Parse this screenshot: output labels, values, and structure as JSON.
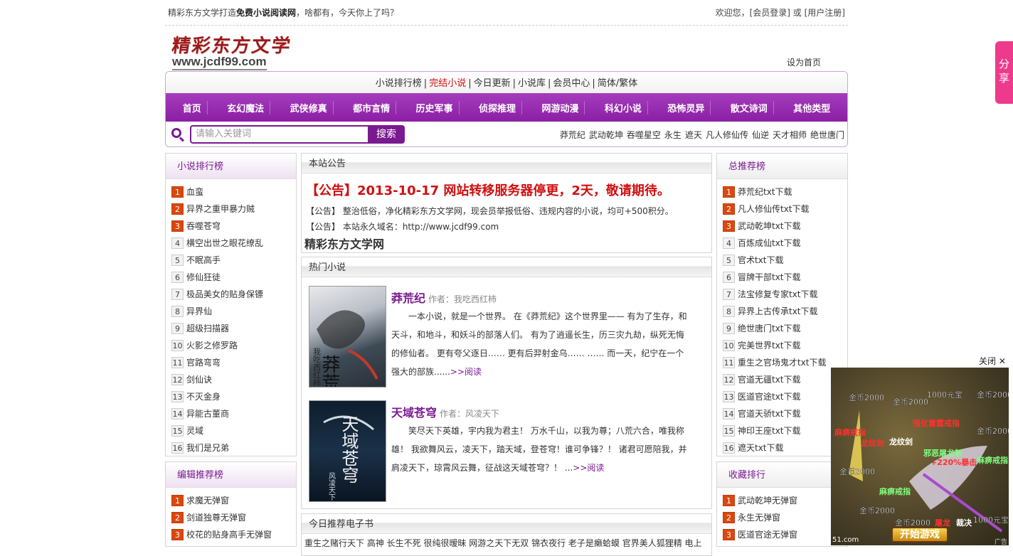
{
  "topbar": {
    "left_prefix": "精彩东方文学打造",
    "left_bold": "免费小说阅读网",
    "left_suffix": "，啥都有，今天你上了吗？",
    "right_welcome": "欢迎您，",
    "login": "[会员登录]",
    "or": " 或 ",
    "register": "[用户注册]"
  },
  "logo": {
    "title": "精彩东方文学",
    "url": "www.jcdf99.com"
  },
  "sethome": "设为首页",
  "subnav": [
    {
      "label": "小说排行榜",
      "red": false
    },
    {
      "label": "完结小说",
      "red": true
    },
    {
      "label": "今日更新",
      "red": false
    },
    {
      "label": "小说库",
      "red": false
    },
    {
      "label": "会员中心",
      "red": false
    },
    {
      "label": "简体/繁体",
      "red": false
    }
  ],
  "mainnav": [
    "首页",
    "玄幻魔法",
    "武侠修真",
    "都市言情",
    "历史军事",
    "侦探推理",
    "网游动漫",
    "科幻小说",
    "恐怖灵异",
    "散文诗词",
    "其他类型"
  ],
  "search": {
    "placeholder": "请输入关键词",
    "button": "搜索"
  },
  "hotwords": [
    "莽荒纪",
    "武动乾坤",
    "吞噬星空",
    "永生",
    "遮天",
    "凡人修仙传",
    "仙逆",
    "天才相师",
    "绝世唐门"
  ],
  "left_rank": {
    "title": "小说排行榜",
    "items": [
      "血蛮",
      "异界之重甲暴力贼",
      "吞噬苍穹",
      "横空出世之眼花缭乱",
      "不眠高手",
      "修仙狂徒",
      "极品美女的贴身保镖",
      "异界仙",
      "超级扫描器",
      "火影之修罗路",
      "官路弯弯",
      "剑仙诀",
      "不灭金身",
      "异能古董商",
      "灵域",
      "我们是兄弟"
    ]
  },
  "left_editor": {
    "title": "编辑推荐榜",
    "items": [
      "求魔无弹窗",
      "剑道独尊无弹窗",
      "校花的贴身高手无弹窗"
    ]
  },
  "notice_panel": {
    "title": "本站公告",
    "main": "【公告】2013-10-17 网站转移服务器停更，2天，敬请期待。",
    "line1": "【公告】 整治低俗，净化精彩东方文学网，现会员举报低俗、违规内容的小说，均可+500积分。",
    "line2": "【公告】 本站永久域名：http://www.jcdf99.com",
    "site": "精彩东方文学网"
  },
  "hot_panel": {
    "title": "热门小说",
    "books": [
      {
        "title": "莽荒纪",
        "author": "作者：我吃西红柿",
        "desc": "一本小说，就是一个世界。 在《莽荒纪》这个世界里—— 有为了生存，和天斗，和地斗，和妖斗的部落人们。 有为了逍遥长生，历三灾九劫，纵死无悔的修仙者。 更有夸父逐日…… 更有后羿射金乌…… …… 而一天，纪宁在一个强大的部族......",
        "more": ">>阅读",
        "cover_text": "莽荒纪",
        "cover_author": "我吃西红柿"
      },
      {
        "title": "天域苍穹",
        "author": "作者：风凌天下",
        "desc": "笑尽天下英雄，宇内我为君主！ 万水千山，以我为尊；八荒六合，唯我称雄！ 我欲舞风云，凌天下，踏天域，登苍穹！谁可争锋？！ 诸君可愿陪我，并肩凌天下，琼霄风云舞，征战这天域苍穹？！ ...",
        "more": ">>阅读",
        "cover_text": "天域苍穹",
        "cover_author": "风凌天下"
      }
    ]
  },
  "today_panel": {
    "title": "今日推荐电子书",
    "text": "重生之赌行天下 高神 长生不死 很纯很暧昧 网游之天下无双 锦衣夜行 老子是癞蛤蟆 官界美人狐狸精 电上"
  },
  "right_rank": {
    "title": "总推荐榜",
    "items": [
      "莽荒纪txt下载",
      "凡人修仙传txt下载",
      "武动乾坤txt下载",
      "百炼成仙txt下载",
      "官术txt下载",
      "冒牌干部txt下载",
      "法宝修复专家txt下载",
      "异界上古传承txt下载",
      "绝世唐门txt下载",
      "完美世界txt下载",
      "重生之官场鬼才txt下载",
      "官道无疆txt下载",
      "医道官途txt下载",
      "官道天骄txt下载",
      "神印王座txt下载",
      "遮天txt下载"
    ]
  },
  "right_collect": {
    "title": "收藏排行",
    "items": [
      "武动乾坤无弹窗",
      "永生无弹窗",
      "医道官途无弹窗"
    ]
  },
  "share": "分享",
  "ad": {
    "close": "关闭",
    "coins": [
      "金币2000",
      "金币2000",
      "1000元宝",
      "金币2000",
      "金币2000",
      "金币2000",
      "金币2000",
      "金币2000",
      "1000元宝"
    ],
    "labels": [
      "强化雷霆戒指",
      "邪恶屠龙斩",
      "+220%暴击",
      "麻痹戒指",
      "麻痹戒指",
      "龙纹剑",
      "屠龙",
      "裁决",
      "龙纹剑",
      "麻痹戒指"
    ],
    "button": "开始游戏",
    "site": "51.com",
    "tag": "广告"
  },
  "colors": {
    "purple": "#7a1a90",
    "nav": "#9a2fb4",
    "red": "#d01010",
    "orange_num": "#d9480f"
  }
}
